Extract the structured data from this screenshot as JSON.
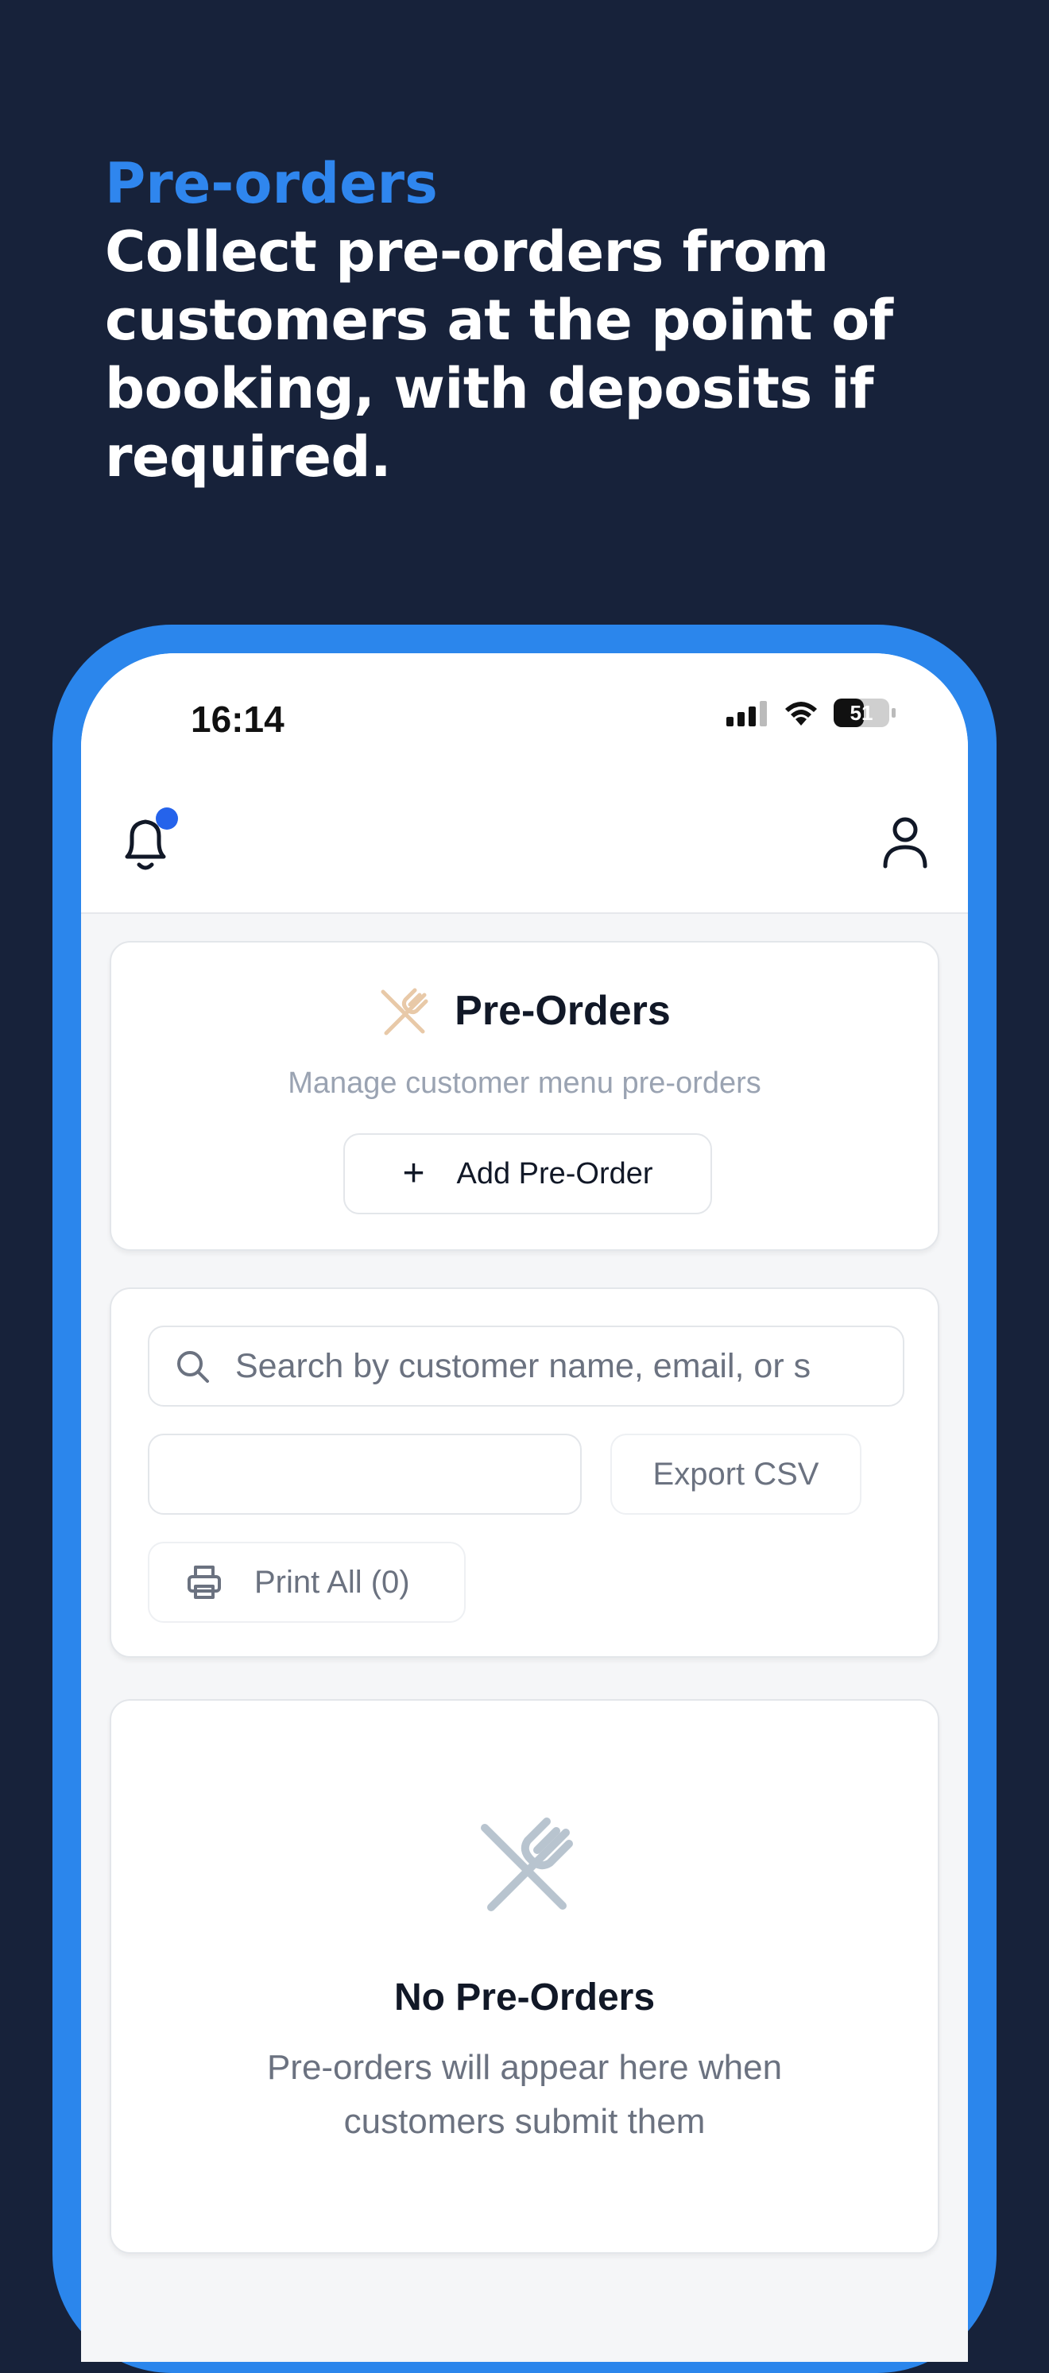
{
  "promo": {
    "kicker": "Pre-orders",
    "headline": "Collect pre-orders from customers at the point of booking, with deposits if required."
  },
  "status_bar": {
    "time": "16:14",
    "battery": "51"
  },
  "app_bar": {
    "bell_icon": "bell-icon",
    "profile_icon": "user-icon",
    "has_notification": true
  },
  "header_card": {
    "title": "Pre-Orders",
    "subtitle": "Manage customer menu pre-orders",
    "add_button_label": "Add Pre-Order",
    "icon": "utensils-crossed-icon"
  },
  "filters": {
    "search_placeholder": "Search by customer name, email, or s",
    "date_value": "",
    "export_label": "Export CSV",
    "print_label": "Print All (0)"
  },
  "empty_state": {
    "title": "No Pre-Orders",
    "message": "Pre-orders will appear here when customers submit them",
    "icon": "utensils-crossed-icon"
  },
  "colors": {
    "background": "#17223a",
    "accent": "#2b86ec",
    "kicker": "#2f86ee",
    "notification_dot": "#2563eb",
    "header_icon": "#e8c9a8",
    "empty_icon": "#b8c4cf"
  }
}
